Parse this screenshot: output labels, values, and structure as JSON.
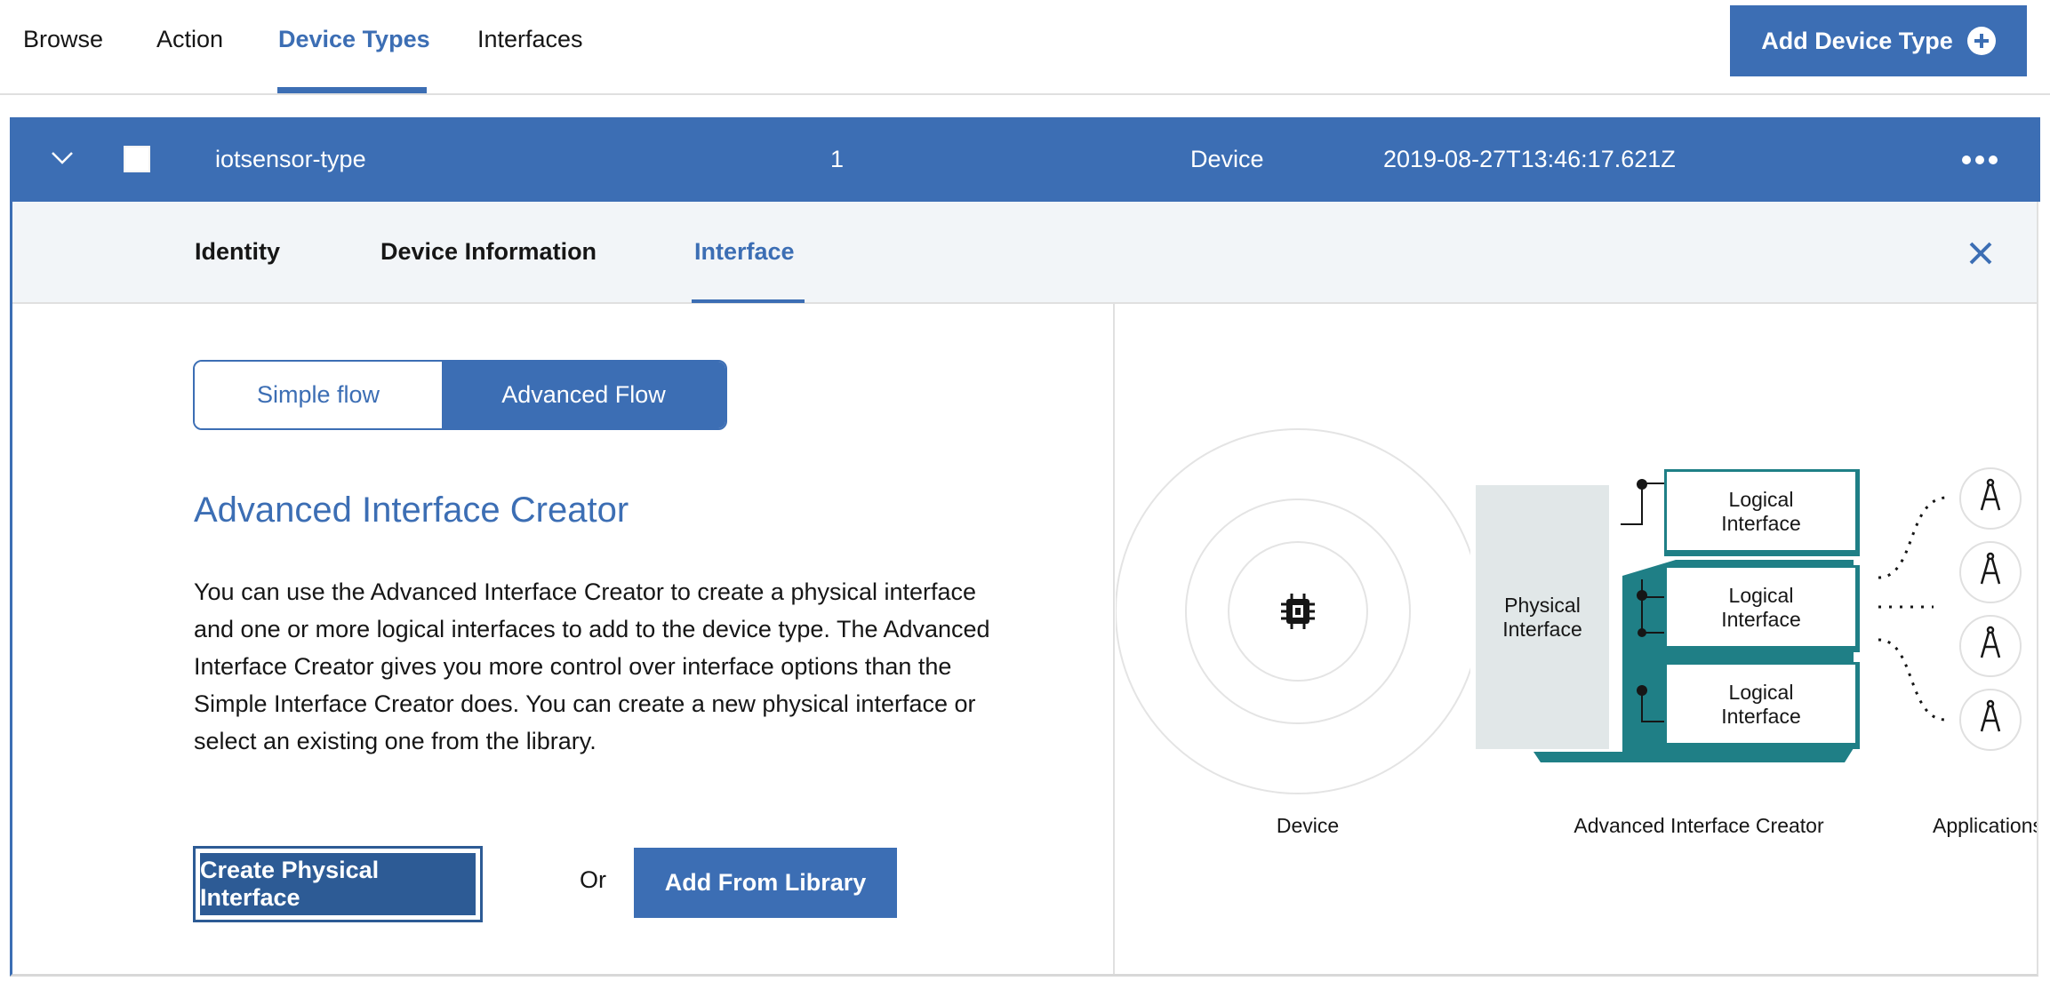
{
  "nav": {
    "tabs": [
      "Browse",
      "Action",
      "Device Types",
      "Interfaces"
    ],
    "active_tab": "Device Types",
    "add_button_label": "Add Device Type"
  },
  "row": {
    "name": "iotsensor-type",
    "count": "1",
    "class": "Device",
    "timestamp": "2019-08-27T13:46:17.621Z"
  },
  "detail_tabs": {
    "items": [
      "Identity",
      "Device Information",
      "Interface"
    ],
    "active": "Interface"
  },
  "flow_toggle": {
    "simple": "Simple flow",
    "advanced": "Advanced Flow",
    "selected": "Advanced Flow"
  },
  "content": {
    "heading": "Advanced Interface Creator",
    "description": "You can use the Advanced Interface Creator to create a physical interface and one or more logical interfaces to add to the device type. The Advanced Interface Creator gives you more control over interface options than the Simple Interface Creator does. You can create a new physical interface or select an existing one from the library.",
    "create_button": "Create Physical Interface",
    "or_text": "Or",
    "library_button": "Add From Library"
  },
  "diagram": {
    "physical_line1": "Physical",
    "physical_line2": "Interface",
    "logical_line1": "Logical",
    "logical_line2": "Interface",
    "label_device": "Device",
    "label_creator": "Advanced Interface Creator",
    "label_applications": "Applications"
  },
  "colors": {
    "primary": "#3c6eb4",
    "primary_dark": "#2d5b95",
    "teal": "#1f7f86",
    "panel_bg": "#f2f5f8"
  },
  "icons": [
    "add-circle-icon",
    "chevron-down-icon",
    "overflow-menu-icon",
    "close-icon",
    "chip-icon",
    "compass-icon"
  ]
}
